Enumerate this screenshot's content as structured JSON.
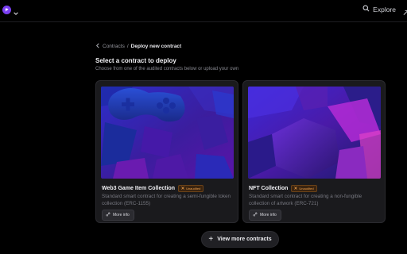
{
  "topbar": {
    "explore_label": "Explore"
  },
  "breadcrumb": {
    "parent": "Contracts",
    "separator": "/",
    "current": "Deploy new contract"
  },
  "page": {
    "title": "Select a contract to deploy",
    "subtitle": "Choose from one of the audited contracts below or upload your own"
  },
  "cards": [
    {
      "title": "Web3 Game Item Collection",
      "badge": "Unaudited",
      "description": "Standard smart contract for creating a semi-fungible token collection (ERC-1155)",
      "more_info": "More info"
    },
    {
      "title": "NFT Collection",
      "badge": "Unaudited",
      "description": "Standard smart contract for creating a non-fungible collection of artwork (ERC-721)",
      "more_info": "More info"
    }
  ],
  "view_more_label": "View more contracts",
  "colors": {
    "background": "#000000",
    "brand": "#7a3ff2",
    "badge_text": "#f0a04b",
    "card": "#1a1a1d"
  },
  "icons": [
    "logo-icon",
    "chevron-down-icon",
    "search-icon",
    "chevron-left-icon",
    "close-icon",
    "link-icon",
    "plus-icon"
  ]
}
